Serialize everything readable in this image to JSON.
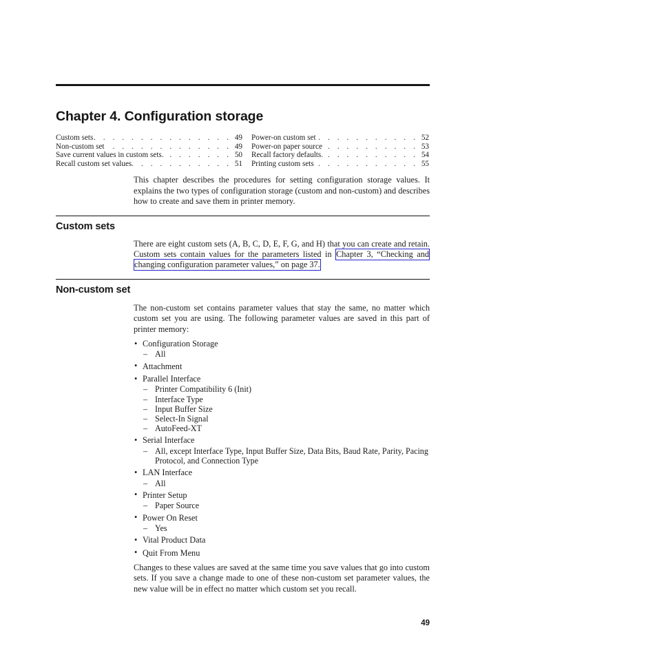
{
  "document": {
    "chapter_title": "Chapter 4. Configuration storage",
    "page_number": "49"
  },
  "toc": {
    "left_column": [
      {
        "label": "Custom sets",
        "page": "49"
      },
      {
        "label": "Non-custom set",
        "page": "49"
      },
      {
        "label": "Save current values in custom sets.",
        "page": "50"
      },
      {
        "label": "Recall custom set values",
        "page": "51"
      }
    ],
    "right_column": [
      {
        "label": "Power-on custom set",
        "page": "52"
      },
      {
        "label": "Power-on paper source",
        "page": "53"
      },
      {
        "label": "Recall factory defaults.",
        "page": "54"
      },
      {
        "label": "Printing custom sets",
        "page": "55"
      }
    ],
    "leader": ". . . . . . . . . . . . . . . . . . . . . . . . . . . . . . . ."
  },
  "intro": {
    "paragraph": "This chapter describes the procedures for setting configuration storage values. It explains the two types of configuration storage (custom and non-custom) and describes how to create and save them in printer memory."
  },
  "custom_sets": {
    "heading": "Custom sets",
    "para_before_link": "There are eight custom sets (A, B, C, D, E, F, G, and H) that you can create and retain. Custom sets contain values for the parameters listed in ",
    "link_text": "Chapter 3, “Checking and changing configuration parameter values,” on page 37.",
    "link_color": "#2424c8"
  },
  "non_custom_set": {
    "heading": "Non-custom set",
    "intro_paragraph": "The non-custom set contains parameter values that stay the same, no matter which custom set you are using. The following parameter values are saved in this part of printer memory:",
    "bullet_glyph": "•",
    "dash_glyph": "–",
    "items": [
      {
        "label": "Configuration Storage",
        "sub": [
          "All"
        ]
      },
      {
        "label": "Attachment",
        "sub": []
      },
      {
        "label": "Parallel Interface",
        "sub": [
          "Printer Compatibility 6 (Init)",
          "Interface Type",
          "Input Buffer Size",
          "Select-In Signal",
          "AutoFeed-XT"
        ]
      },
      {
        "label": "Serial Interface",
        "sub": [
          "All, except Interface Type, Input Buffer Size, Data Bits, Baud Rate, Parity, Pacing Protocol, and Connection Type"
        ]
      },
      {
        "label": "LAN Interface",
        "sub": [
          "All"
        ]
      },
      {
        "label": "Printer Setup",
        "sub": [
          "Paper Source"
        ]
      },
      {
        "label": "Power On Reset",
        "sub": [
          "Yes"
        ]
      },
      {
        "label": "Vital Product Data",
        "sub": []
      },
      {
        "label": "Quit From Menu",
        "sub": []
      }
    ],
    "closing_paragraph": "Changes to these values are saved at the same time you save values that go into custom sets. If you save a change made to one of these non-custom set parameter values, the new value will be in effect no matter which custom set you recall."
  }
}
